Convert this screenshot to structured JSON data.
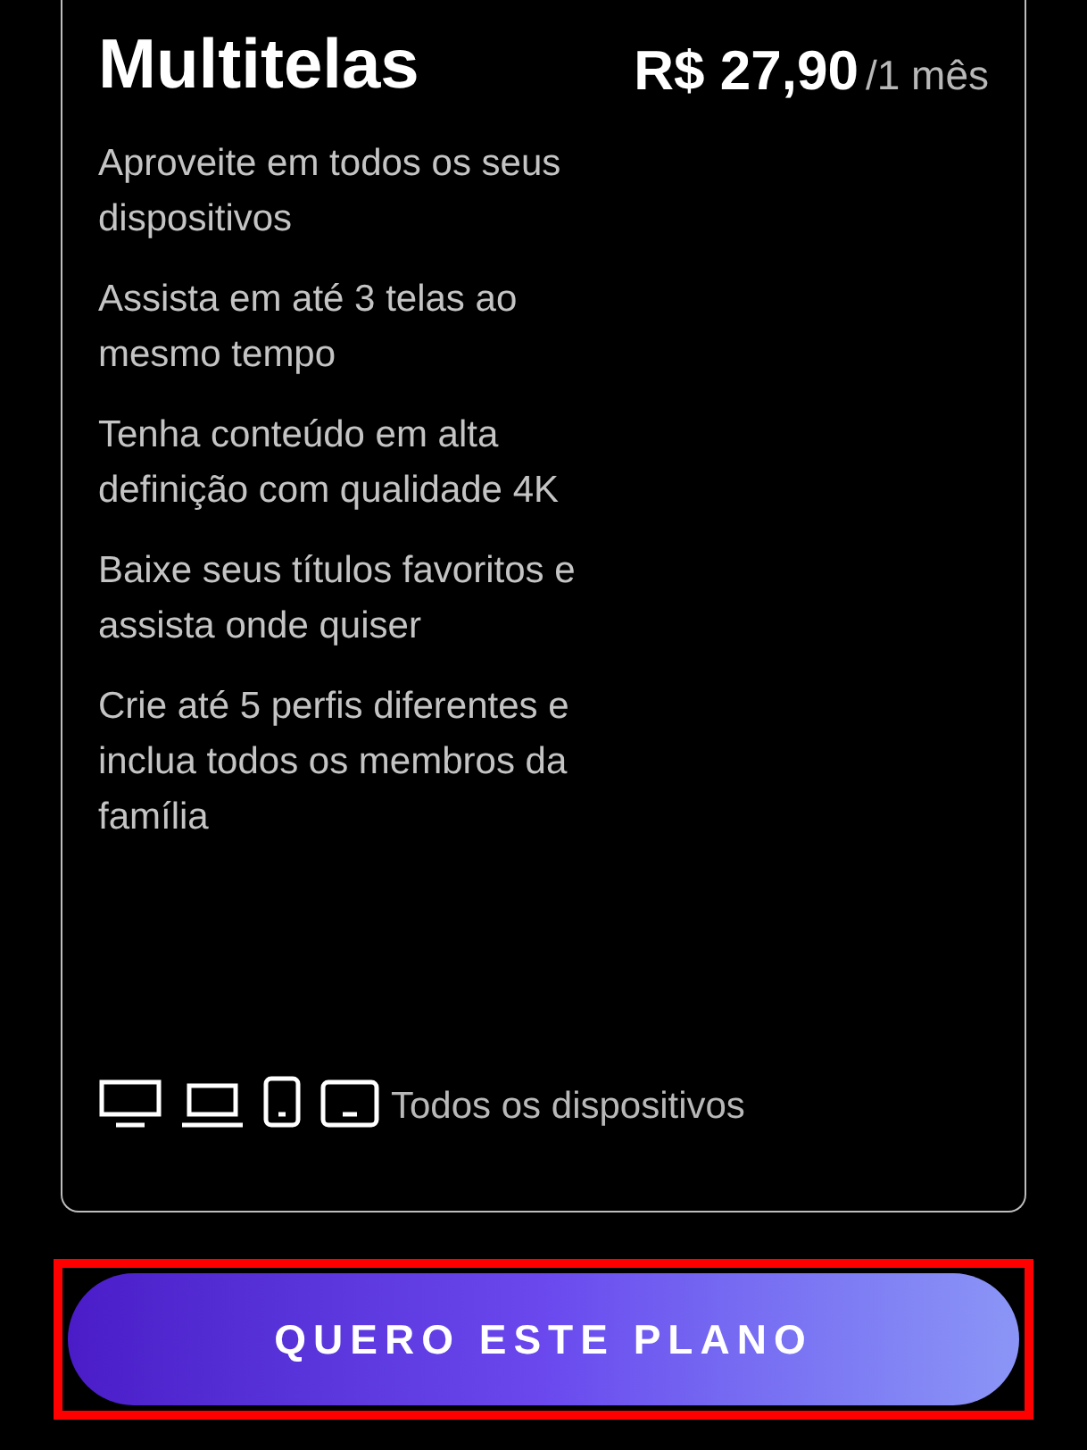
{
  "plan": {
    "title": "Multitelas",
    "price": "R$ 27,90",
    "period": "/1 mês",
    "features": [
      "Aproveite em todos os seus dispositivos",
      "Assista em até 3 telas ao mesmo tempo",
      "Tenha conteúdo em alta definição com qualidade 4K",
      "Baixe seus títulos favoritos e assista onde quiser",
      "Crie até 5 perfis diferentes e inclua todos os membros da família"
    ],
    "devices": {
      "icons": [
        {
          "kind": "monitor"
        },
        {
          "kind": "laptop"
        },
        {
          "kind": "phone"
        },
        {
          "kind": "tablet"
        }
      ],
      "label": "Todos os dispositivos"
    }
  },
  "cta": {
    "label": "QUERO ESTE PLANO",
    "highlighted": true
  }
}
